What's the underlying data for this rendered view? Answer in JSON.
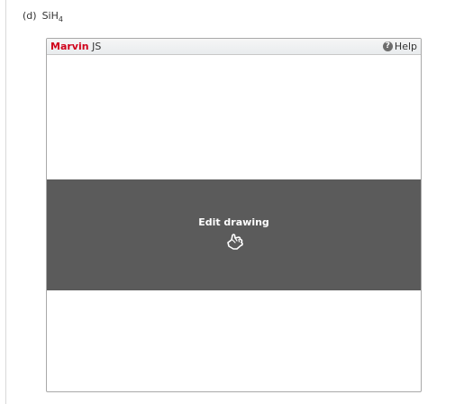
{
  "question": {
    "part": "(d)",
    "formula_main": "SiH",
    "formula_subscript": "4"
  },
  "marvin": {
    "brand_strong": "Marvin",
    "brand_rest": " JS",
    "help_icon_glyph": "?",
    "help_label": "Help",
    "edit_label": "Edit drawing",
    "edit_icon": "pointing-hand-icon",
    "brand_color": "#d0021b",
    "overlay_color": "#5b5b5b"
  }
}
